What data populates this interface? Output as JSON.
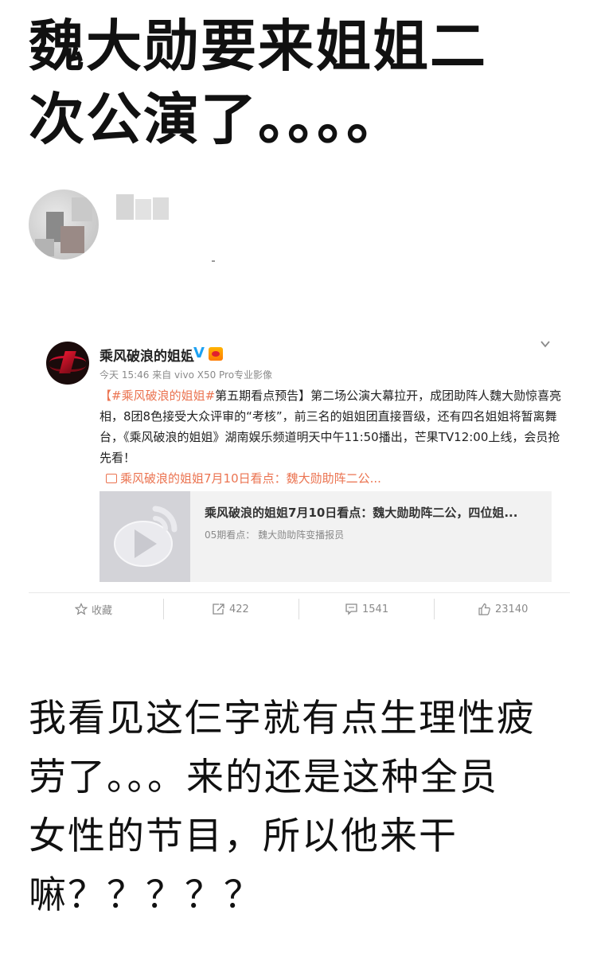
{
  "headline": {
    "line1": "魏大勋要来姐姐二",
    "line2": "次公演了。。。。"
  },
  "embedded_post": {
    "account_name": "乘风破浪的姐姐",
    "meta": "今天 15:46 来自 vivo X50 Pro专业影像",
    "body": {
      "hashtag": "【#乘风破浪的姐姐#",
      "text": "第五期看点预告】第二场公演大幕拉开，成团助阵人魏大勋惊喜亮相，8团8色接受大众评审的“考核”，前三名的姐姐团直接晋级，还有四名姐姐将暂离舞台，《乘风破浪的姐姐》湖南娱乐频道明天中午11:50播出，芒果TV12:00上线，会员抢先看！"
    },
    "video_link": "乘风破浪的姐姐7月10日看点：魏大勋助阵二公...",
    "video_card": {
      "title": "乘风破浪的姐姐7月10日看点：魏大勋助阵二公，四位姐...",
      "subtitle": "05期看点：  魏大勋助阵变播报员"
    },
    "actions": {
      "favorite": "收藏",
      "repost": "422",
      "comment": "1541",
      "like": "23140"
    }
  },
  "comment": {
    "line1": "我看见这仨字就有点生理性疲",
    "line2": "劳了。。。来的还是这种全员",
    "line3": "女性的节目，所以他来干",
    "line4": "嘛？？？？？"
  },
  "colors": {
    "link": "#eb7350",
    "verified": "#1da1f2"
  }
}
